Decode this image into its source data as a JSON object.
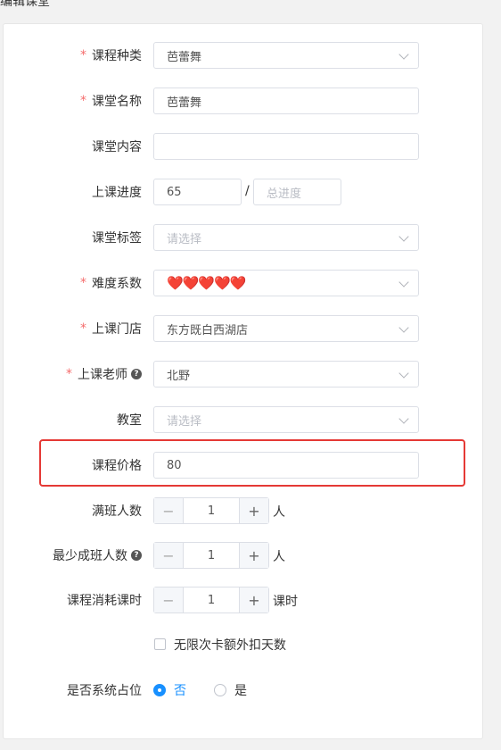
{
  "page": {
    "top_title": "编辑课堂"
  },
  "fields": {
    "course_type": {
      "label": "课程种类",
      "required": true,
      "value": "芭蕾舞"
    },
    "class_name": {
      "label": "课堂名称",
      "required": true,
      "value": "芭蕾舞"
    },
    "class_content": {
      "label": "课堂内容",
      "value": ""
    },
    "progress": {
      "label": "上课进度",
      "value": "65",
      "separator": "/",
      "total_placeholder": "总进度"
    },
    "class_tags": {
      "label": "课堂标签",
      "placeholder": "请选择"
    },
    "difficulty": {
      "label": "难度系数",
      "required": true,
      "value": "❤️❤️❤️❤️❤️",
      "level": 5
    },
    "store": {
      "label": "上课门店",
      "required": true,
      "value": "东方既白西湖店"
    },
    "teacher": {
      "label": "上课老师",
      "required": true,
      "value": "北野"
    },
    "classroom": {
      "label": "教室",
      "placeholder": "请选择"
    },
    "price": {
      "label": "课程价格",
      "value": "80"
    },
    "full_class": {
      "label": "满班人数",
      "value": "1",
      "unit": "人"
    },
    "min_class": {
      "label": "最少成班人数",
      "value": "1",
      "unit": "人"
    },
    "hours": {
      "label": "课程消耗课时",
      "value": "1",
      "unit": "课时"
    },
    "unlimited_card": {
      "label": "无限次卡额外扣天数",
      "checked": false
    },
    "system_slot": {
      "label": "是否系统占位",
      "options": [
        "否",
        "是"
      ],
      "selected": "否"
    }
  },
  "symbols": {
    "required": "*",
    "help": "?",
    "minus": "−",
    "plus": "+"
  },
  "colors": {
    "required": "#f56c6c",
    "primary": "#1890ff",
    "highlight": "#e53935"
  }
}
